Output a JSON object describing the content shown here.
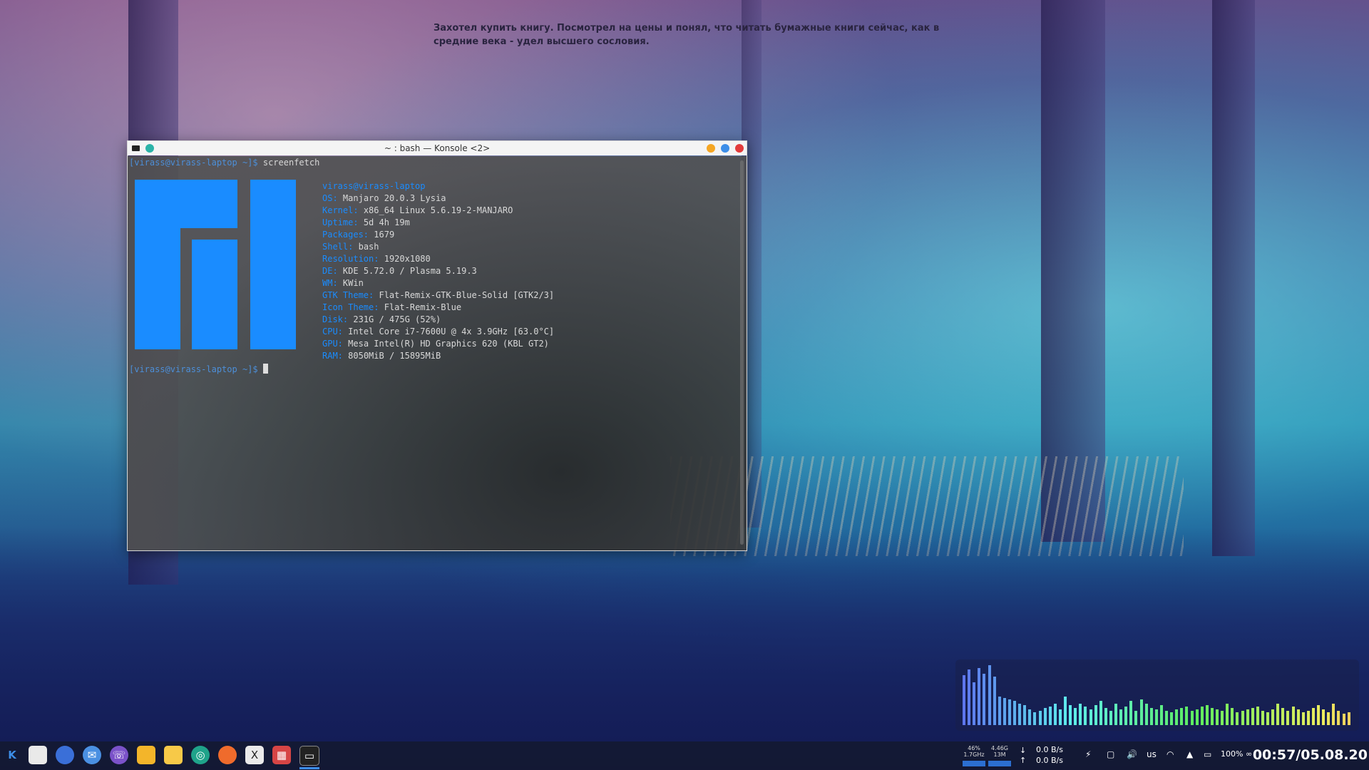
{
  "desktop": {
    "quote": "Захотел купить книгу. Посмотрел на цены и понял, что читать бумажные книги сейчас, как в средние века - удел высшего сословия."
  },
  "konsole": {
    "title": "~ : bash — Konsole <2>",
    "prompt": "[virass@virass-laptop ~]$",
    "command": "screenfetch",
    "user_host": "virass@virass-laptop",
    "info": [
      {
        "key": "OS:",
        "value": "Manjaro 20.0.3 Lysia"
      },
      {
        "key": "Kernel:",
        "value": "x86_64 Linux 5.6.19-2-MANJARO"
      },
      {
        "key": "Uptime:",
        "value": "5d 4h 19m"
      },
      {
        "key": "Packages:",
        "value": "1679"
      },
      {
        "key": "Shell:",
        "value": "bash"
      },
      {
        "key": "Resolution:",
        "value": "1920x1080"
      },
      {
        "key": "DE:",
        "value": "KDE 5.72.0 / Plasma 5.19.3"
      },
      {
        "key": "WM:",
        "value": "KWin"
      },
      {
        "key": "GTK Theme:",
        "value": "Flat-Remix-GTK-Blue-Solid [GTK2/3]"
      },
      {
        "key": "Icon Theme:",
        "value": "Flat-Remix-Blue"
      },
      {
        "key": "Disk:",
        "value": "231G / 475G (52%)"
      },
      {
        "key": "CPU:",
        "value": "Intel Core i7-7600U @ 4x 3.9GHz [63.0°C]"
      },
      {
        "key": "GPU:",
        "value": "Mesa Intel(R) HD Graphics 620 (KBL GT2)"
      },
      {
        "key": "RAM:",
        "value": "8050MiB / 15895MiB"
      }
    ],
    "colors": {
      "accent": "#1a8cff",
      "prompt": "#4c8fd9"
    }
  },
  "taskbar": {
    "launchers": [
      {
        "icon": "kde-menu-icon"
      },
      {
        "icon": "file-manager-icon"
      },
      {
        "icon": "app-icon"
      },
      {
        "icon": "mail-icon"
      },
      {
        "icon": "viber-icon"
      },
      {
        "icon": "folder-icon"
      },
      {
        "icon": "notes-icon"
      },
      {
        "icon": "globe-icon"
      },
      {
        "icon": "firefox-icon"
      },
      {
        "icon": "x-icon"
      },
      {
        "icon": "calculator-icon"
      },
      {
        "icon": "terminal-icon"
      }
    ],
    "cpu_mini": {
      "pct": "46%",
      "freq": "1.7GHz"
    },
    "mem_mini": {
      "total": "4.46G",
      "used": "13M"
    },
    "net_down": "0.0 B/s",
    "net_up": "0.0 B/s",
    "keyboard_layout": "us",
    "battery": "100% ∞",
    "clock": "00:57/05.08.20"
  }
}
